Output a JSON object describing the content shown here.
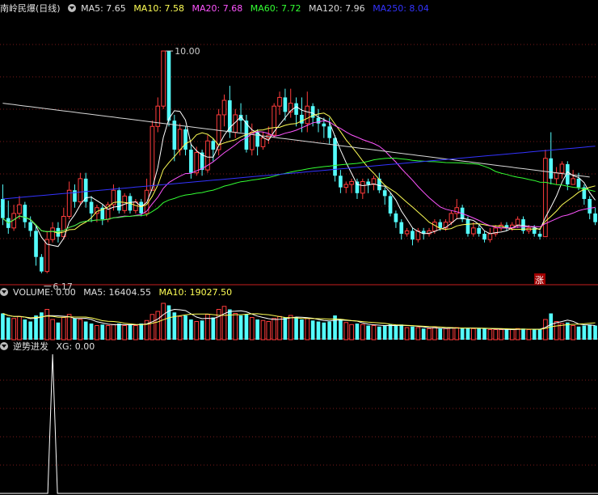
{
  "colors": {
    "background": "#000000",
    "up": "#ff3c3c",
    "down": "#54fcfc",
    "ma5": "#ffffff",
    "ma10": "#ffff55",
    "ma20": "#ff55ff",
    "ma60": "#33ff33",
    "ma120": "#d8d8d8",
    "ma250": "#3333ff",
    "grid": "#7a1a1a",
    "divider": "#c81e1e",
    "signal": "#ffffff"
  },
  "main_panel": {
    "title": "南岭民爆(日线)",
    "ma5": "MA5: 7.65",
    "ma10": "MA10: 7.58",
    "ma20": "MA20: 7.68",
    "ma60": "MA60: 7.72",
    "ma120": "MA120: 7.96",
    "ma250": "MA250: 8.04",
    "high_label": "10.00",
    "low_label": "6.17",
    "badge": "涨"
  },
  "volume_panel": {
    "vol": "VOLUME: 0.00",
    "ma5": "MA5: 16404.55",
    "ma10": "MA10: 19027.50"
  },
  "signal_panel": {
    "title": "逆势进发",
    "xg": "XG: 0.00"
  },
  "chart_data": {
    "type": "candlestick",
    "price_ylim": [
      6.0,
      10.6
    ],
    "volume_ylim": [
      0,
      40000
    ],
    "signal_ylim": [
      0,
      1
    ],
    "candles": [
      [
        7.45,
        7.12,
        7.7,
        7.0,
        26000
      ],
      [
        7.12,
        6.95,
        7.42,
        6.85,
        22000
      ],
      [
        6.95,
        7.2,
        7.35,
        6.9,
        21000
      ],
      [
        7.2,
        7.35,
        7.5,
        7.1,
        23000
      ],
      [
        7.35,
        7.05,
        7.4,
        6.95,
        20000
      ],
      [
        7.05,
        6.9,
        7.15,
        6.8,
        18000
      ],
      [
        6.9,
        6.45,
        7.0,
        6.3,
        24000
      ],
      [
        6.45,
        6.2,
        6.5,
        6.17,
        27000
      ],
      [
        6.2,
        6.75,
        6.9,
        6.17,
        30000
      ],
      [
        6.75,
        6.95,
        7.05,
        6.7,
        20000
      ],
      [
        6.95,
        6.8,
        7.05,
        6.7,
        17000
      ],
      [
        6.8,
        7.15,
        7.3,
        6.75,
        22000
      ],
      [
        7.15,
        7.6,
        7.75,
        7.1,
        25000
      ],
      [
        7.6,
        7.4,
        7.7,
        7.3,
        21000
      ],
      [
        7.4,
        7.8,
        7.9,
        7.35,
        20000
      ],
      [
        7.8,
        7.4,
        7.9,
        7.3,
        18000
      ],
      [
        7.4,
        7.2,
        7.5,
        7.05,
        16000
      ],
      [
        7.2,
        7.3,
        7.35,
        7.05,
        14000
      ],
      [
        7.3,
        7.1,
        7.35,
        7.0,
        15000
      ],
      [
        7.1,
        7.35,
        7.4,
        7.05,
        14000
      ],
      [
        7.35,
        7.6,
        7.7,
        7.25,
        15000
      ],
      [
        7.6,
        7.25,
        7.65,
        7.2,
        16000
      ],
      [
        7.25,
        7.5,
        7.55,
        7.2,
        14000
      ],
      [
        7.5,
        7.25,
        7.55,
        7.2,
        15000
      ],
      [
        7.25,
        7.4,
        7.45,
        7.2,
        14000
      ],
      [
        7.4,
        7.2,
        7.45,
        7.15,
        16000
      ],
      [
        7.2,
        7.6,
        7.8,
        7.15,
        19000
      ],
      [
        7.6,
        8.7,
        8.8,
        7.6,
        25000
      ],
      [
        8.7,
        9.05,
        9.2,
        8.6,
        28000
      ],
      [
        9.05,
        10.0,
        10.0,
        9.0,
        36000
      ],
      [
        10.0,
        8.8,
        10.0,
        8.7,
        34000
      ],
      [
        8.8,
        8.3,
        8.9,
        8.1,
        27000
      ],
      [
        8.3,
        8.65,
        8.75,
        8.2,
        23000
      ],
      [
        8.65,
        8.3,
        8.7,
        8.2,
        24000
      ],
      [
        8.3,
        7.9,
        8.4,
        7.8,
        20000
      ],
      [
        7.9,
        8.25,
        8.35,
        7.85,
        18000
      ],
      [
        8.25,
        7.95,
        8.3,
        7.85,
        19000
      ],
      [
        7.95,
        8.45,
        8.55,
        7.9,
        25000
      ],
      [
        8.45,
        8.3,
        8.5,
        8.1,
        22000
      ],
      [
        8.3,
        8.9,
        9.0,
        8.2,
        30000
      ],
      [
        8.9,
        9.15,
        9.25,
        8.7,
        33000
      ],
      [
        9.15,
        8.6,
        9.4,
        8.5,
        30000
      ],
      [
        8.6,
        8.9,
        9.0,
        8.5,
        26000
      ],
      [
        8.9,
        8.8,
        9.1,
        8.6,
        24000
      ],
      [
        8.8,
        8.3,
        8.9,
        8.25,
        25000
      ],
      [
        8.3,
        8.6,
        8.75,
        8.2,
        22000
      ],
      [
        8.6,
        8.35,
        8.65,
        8.2,
        20000
      ],
      [
        8.35,
        8.5,
        8.6,
        8.3,
        19000
      ],
      [
        8.5,
        8.55,
        8.7,
        8.4,
        18000
      ],
      [
        8.55,
        9.05,
        9.1,
        8.5,
        21000
      ],
      [
        9.05,
        9.2,
        9.3,
        8.9,
        23000
      ],
      [
        9.2,
        8.95,
        9.35,
        8.8,
        22000
      ],
      [
        8.95,
        9.1,
        9.35,
        8.85,
        24000
      ],
      [
        9.1,
        8.9,
        9.2,
        8.7,
        22000
      ],
      [
        8.9,
        8.75,
        9.2,
        8.6,
        20000
      ],
      [
        8.75,
        9.05,
        9.3,
        8.6,
        21000
      ],
      [
        9.05,
        8.85,
        9.1,
        8.7,
        19000
      ],
      [
        8.85,
        8.75,
        9.0,
        8.6,
        18000
      ],
      [
        8.75,
        8.7,
        8.85,
        8.5,
        17000
      ],
      [
        8.7,
        8.5,
        8.85,
        8.4,
        18000
      ],
      [
        8.5,
        7.85,
        8.55,
        7.75,
        24000
      ],
      [
        7.85,
        7.65,
        7.95,
        7.55,
        20000
      ],
      [
        7.65,
        7.7,
        7.75,
        7.55,
        17000
      ],
      [
        7.7,
        7.75,
        7.8,
        7.55,
        15000
      ],
      [
        7.75,
        7.55,
        7.8,
        7.45,
        16000
      ],
      [
        7.55,
        7.75,
        7.8,
        7.45,
        15000
      ],
      [
        7.75,
        7.7,
        7.8,
        7.55,
        14000
      ],
      [
        7.7,
        7.8,
        7.85,
        7.6,
        14000
      ],
      [
        7.8,
        7.6,
        7.9,
        7.55,
        13000
      ],
      [
        7.6,
        7.5,
        7.65,
        7.35,
        14000
      ],
      [
        7.5,
        7.2,
        7.55,
        7.15,
        15000
      ],
      [
        7.2,
        7.05,
        7.25,
        6.95,
        14000
      ],
      [
        7.05,
        6.85,
        7.1,
        6.75,
        15000
      ],
      [
        6.85,
        6.9,
        6.95,
        6.8,
        12000
      ],
      [
        6.9,
        6.75,
        6.95,
        6.65,
        13000
      ],
      [
        6.75,
        6.9,
        6.95,
        6.7,
        12000
      ],
      [
        6.9,
        6.85,
        6.95,
        6.75,
        11000
      ],
      [
        6.85,
        6.9,
        6.95,
        6.8,
        11000
      ],
      [
        6.9,
        7.05,
        7.1,
        6.85,
        12000
      ],
      [
        7.05,
        6.95,
        7.1,
        6.9,
        11000
      ],
      [
        6.95,
        7.05,
        7.1,
        6.9,
        11000
      ],
      [
        7.05,
        7.2,
        7.25,
        7.0,
        12000
      ],
      [
        7.2,
        7.3,
        7.45,
        7.1,
        12000
      ],
      [
        7.3,
        7.1,
        7.35,
        7.05,
        11000
      ],
      [
        7.1,
        6.85,
        7.15,
        6.8,
        12000
      ],
      [
        6.85,
        6.95,
        7.05,
        6.8,
        11000
      ],
      [
        6.95,
        6.85,
        7.0,
        6.8,
        11000
      ],
      [
        6.85,
        6.75,
        6.9,
        6.7,
        11000
      ],
      [
        6.75,
        6.85,
        6.95,
        6.7,
        10000
      ],
      [
        6.85,
        6.95,
        7.0,
        6.8,
        10000
      ],
      [
        6.95,
        7.0,
        7.05,
        6.9,
        10000
      ],
      [
        7.0,
        6.95,
        7.05,
        6.9,
        10000
      ],
      [
        6.95,
        7.0,
        7.05,
        6.9,
        10000
      ],
      [
        7.0,
        7.1,
        7.15,
        6.95,
        11000
      ],
      [
        7.1,
        6.9,
        7.15,
        6.85,
        11000
      ],
      [
        6.9,
        6.95,
        7.0,
        6.85,
        10000
      ],
      [
        6.95,
        6.85,
        7.0,
        6.8,
        10000
      ],
      [
        6.85,
        6.8,
        6.9,
        6.75,
        10000
      ],
      [
        6.8,
        8.15,
        8.3,
        6.8,
        20000
      ],
      [
        8.15,
        7.8,
        8.6,
        7.7,
        26000
      ],
      [
        7.8,
        7.9,
        8.0,
        7.7,
        18000
      ],
      [
        7.9,
        8.05,
        8.1,
        7.8,
        16000
      ],
      [
        8.05,
        7.7,
        8.1,
        7.6,
        17000
      ],
      [
        7.7,
        7.8,
        7.95,
        7.7,
        14000
      ],
      [
        7.8,
        7.65,
        7.9,
        7.6,
        13000
      ],
      [
        7.65,
        7.45,
        7.7,
        7.35,
        14000
      ],
      [
        7.45,
        7.2,
        7.5,
        7.1,
        15000
      ],
      [
        7.2,
        7.05,
        7.3,
        7.0,
        14000
      ]
    ],
    "signal_index": 9
  }
}
